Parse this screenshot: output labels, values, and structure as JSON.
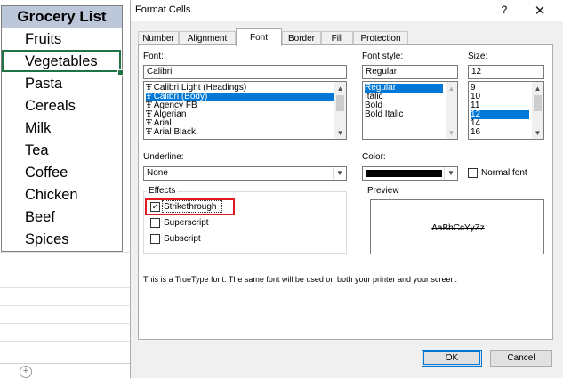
{
  "sheet": {
    "header": "Grocery List",
    "items": [
      "Fruits",
      "Vegetables",
      "Pasta",
      "Cereals",
      "Milk",
      "Tea",
      "Coffee",
      "Chicken",
      "Beef",
      "Spices"
    ],
    "active_cell": "Vegetables"
  },
  "dialog": {
    "title": "Format Cells",
    "help_glyph": "?",
    "close_glyph": "✕",
    "tabs": [
      "Number",
      "Alignment",
      "Font",
      "Border",
      "Fill",
      "Protection"
    ],
    "active_tab": "Font",
    "font": {
      "label": "Font:",
      "value": "Calibri",
      "list": [
        "Calibri Light (Headings)",
        "Calibri (Body)",
        "Agency FB",
        "Algerian",
        "Arial",
        "Arial Black"
      ],
      "selected": "Calibri (Body)"
    },
    "font_style": {
      "label": "Font style:",
      "value": "Regular",
      "list": [
        "Regular",
        "Italic",
        "Bold",
        "Bold Italic"
      ],
      "selected": "Regular"
    },
    "size": {
      "label": "Size:",
      "value": "12",
      "list": [
        "9",
        "10",
        "11",
        "12",
        "14",
        "16"
      ],
      "selected": "12"
    },
    "underline": {
      "label": "Underline:",
      "value": "None"
    },
    "color": {
      "label": "Color:",
      "swatch": "#000000",
      "normal_font_label": "Normal font",
      "normal_font_checked": false
    },
    "effects": {
      "title": "Effects",
      "strikethrough": {
        "label": "Strikethrough",
        "checked": true
      },
      "superscript": {
        "label": "Superscript",
        "checked": false
      },
      "subscript": {
        "label": "Subscript",
        "checked": false
      }
    },
    "preview": {
      "title": "Preview",
      "sample": "AaBbCcYyZz"
    },
    "info": "This is a TrueType font.  The same font will be used on both your printer and your screen.",
    "buttons": {
      "ok": "OK",
      "cancel": "Cancel"
    },
    "highlight_color": "#e31c23",
    "selection_color": "#0078d7"
  }
}
